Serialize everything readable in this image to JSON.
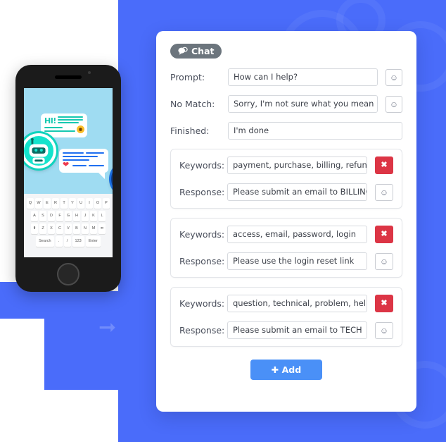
{
  "theme": {
    "accent_blue": "#4a6cfa",
    "button_blue": "#4a90f7",
    "badge_gray": "#6c757d",
    "danger_red": "#dc3545",
    "phone_screen_blue": "#9fdcf2"
  },
  "panel": {
    "badge": {
      "label": "Chat",
      "icon": "chat-bubbles-icon"
    },
    "fields": [
      {
        "label": "Prompt:",
        "value": "How can I help?",
        "placeholder": "How can I help?",
        "has_emoji_button": true,
        "emoji_icon": "smiley-icon"
      },
      {
        "label": "No Match:",
        "value": "Sorry, I'm not sure what you mean",
        "placeholder": "Sorry, I'm not sure what you mean",
        "has_emoji_button": true,
        "emoji_icon": "smiley-icon"
      },
      {
        "label": "Finished:",
        "value": "I'm done",
        "placeholder": "I'm done",
        "has_emoji_button": false,
        "emoji_icon": ""
      }
    ],
    "rule_labels": {
      "keywords": "Keywords:",
      "response": "Response:",
      "delete_icon": "close-x-icon",
      "emoji_icon": "smiley-icon"
    },
    "rules": [
      {
        "keywords": "payment, purchase, billing, refund",
        "response": "Please submit an email to BILLING"
      },
      {
        "keywords": "access, email, password, login",
        "response": "Please use the login reset link"
      },
      {
        "keywords": "question, technical, problem, help",
        "response": "Please submit an email to TECH"
      }
    ],
    "add_button": {
      "label": "Add",
      "icon": "plus-icon"
    }
  },
  "phone": {
    "chat": {
      "bot_greeting": "HI!",
      "bot_avatar": "robot-avatar",
      "user_avatar": "person-avatar",
      "bot_emoji": "grin-emoji",
      "user_heart": "heart-icon"
    },
    "keyboard": {
      "row1": [
        "Q",
        "W",
        "E",
        "R",
        "T",
        "Y",
        "U",
        "I",
        "O",
        "P"
      ],
      "row2": [
        "A",
        "S",
        "D",
        "F",
        "G",
        "H",
        "J",
        "K",
        "L"
      ],
      "row3": [
        "⬆",
        "Z",
        "X",
        "C",
        "V",
        "B",
        "N",
        "M",
        "⬅"
      ],
      "row4": [
        "Search",
        ".",
        "/",
        "123",
        "Enter"
      ]
    }
  }
}
